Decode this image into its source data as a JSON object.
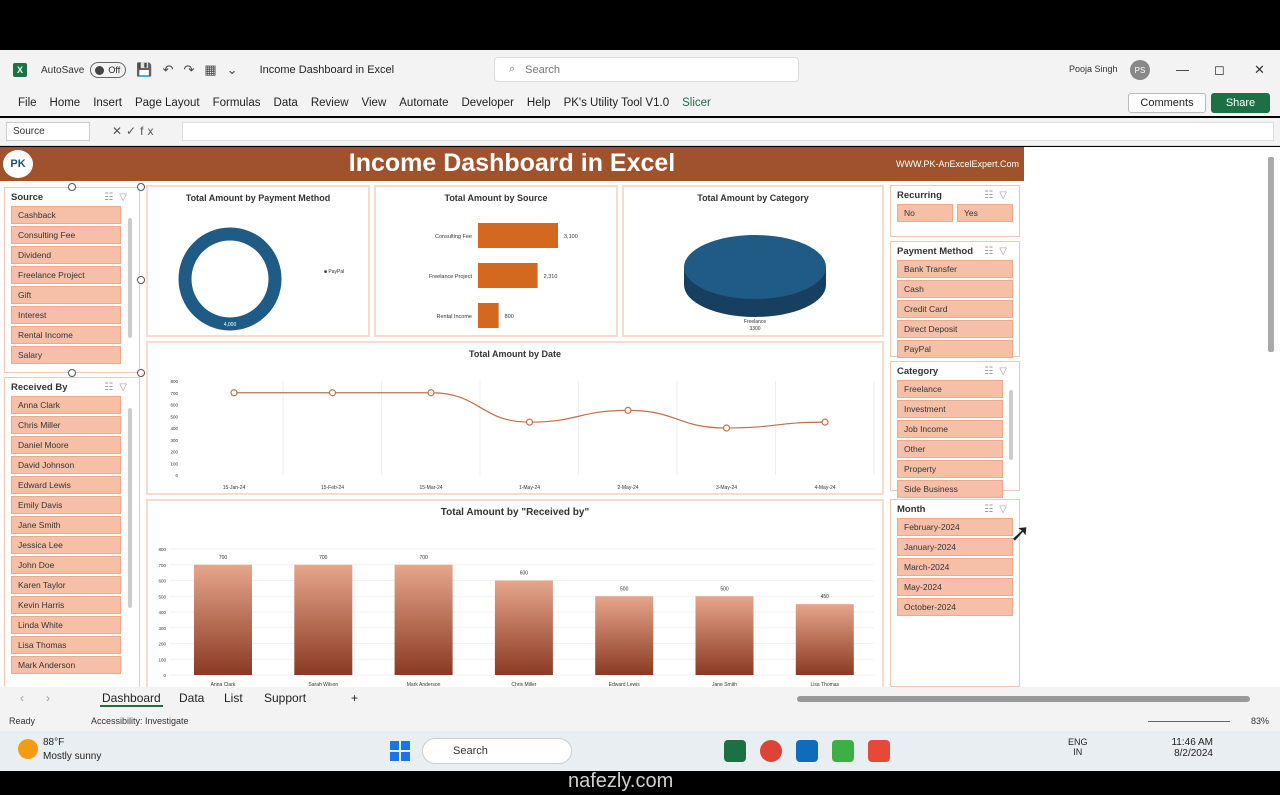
{
  "window": {
    "autosave_label": "AutoSave",
    "autosave_state": "Off",
    "doc_title": "Income Dashboard in Excel",
    "search_placeholder": "Search",
    "user_name": "Pooja Singh",
    "user_initials": "PS"
  },
  "ribbon": {
    "tabs": [
      "File",
      "Home",
      "Insert",
      "Page Layout",
      "Formulas",
      "Data",
      "Review",
      "View",
      "Automate",
      "Developer",
      "Help",
      "PK's Utility Tool V1.0",
      "Slicer"
    ],
    "comments_label": "Comments",
    "share_label": "Share"
  },
  "formula_bar": {
    "name_box": "Source",
    "fx": "fx"
  },
  "dashboard": {
    "title": "Income Dashboard in Excel",
    "url": "WWW.PK-AnExcelExpert.Com",
    "logo_text": "PK"
  },
  "slicers": {
    "source": {
      "title": "Source",
      "items": [
        "Cashback",
        "Consulting Fee",
        "Dividend",
        "Freelance Project",
        "Gift",
        "Interest",
        "Rental Income",
        "Salary"
      ]
    },
    "received_by": {
      "title": "Received By",
      "items": [
        "Anna Clark",
        "Chris Miller",
        "Daniel Moore",
        "David Johnson",
        "Edward Lewis",
        "Emily Davis",
        "Jane Smith",
        "Jessica Lee",
        "John Doe",
        "Karen Taylor",
        "Kevin Harris",
        "Linda White",
        "Lisa Thomas",
        "Mark Anderson"
      ]
    },
    "recurring": {
      "title": "Recurring",
      "items": [
        "No",
        "Yes"
      ]
    },
    "payment_method": {
      "title": "Payment Method",
      "items": [
        "Bank Transfer",
        "Cash",
        "Credit Card",
        "Direct Deposit",
        "PayPal"
      ]
    },
    "category": {
      "title": "Category",
      "items": [
        "Freelance",
        "Investment",
        "Job Income",
        "Other",
        "Property",
        "Side Business"
      ]
    },
    "month": {
      "title": "Month",
      "items": [
        "February-2024",
        "January-2024",
        "March-2024",
        "May-2024",
        "October-2024"
      ]
    }
  },
  "charts": {
    "payment": {
      "title": "Total Amount by Payment Method"
    },
    "source": {
      "title": "Total Amount by Source"
    },
    "category": {
      "title": "Total Amount by Category"
    },
    "date": {
      "title": "Total Amount by Date"
    },
    "received": {
      "title": "Total Amount by \"Received by\""
    }
  },
  "chart_data": [
    {
      "type": "pie",
      "title": "Total Amount by Payment Method",
      "categories": [
        "PayPal"
      ],
      "values": [
        4000
      ],
      "labels": [
        "PayPal",
        "4,000"
      ],
      "style": "doughnut"
    },
    {
      "type": "bar",
      "title": "Total Amount by Source",
      "orientation": "horizontal",
      "categories": [
        "Consulting Fee",
        "Freelance Project",
        "Rental Income"
      ],
      "values": [
        3100,
        2310,
        800
      ],
      "value_labels": [
        "3,100",
        "2,310",
        "800"
      ]
    },
    {
      "type": "pie",
      "title": "Total Amount by Category",
      "categories": [
        "Freelance"
      ],
      "values": [
        3300
      ],
      "labels": [
        "Freelance",
        "3300"
      ]
    },
    {
      "type": "line",
      "title": "Total Amount by Date",
      "x": [
        "15-Jan-24",
        "15-Feb-24",
        "15-Mar-24",
        "1-May-24",
        "2-May-24",
        "3-May-24",
        "4-May-24"
      ],
      "values": [
        700,
        700,
        700,
        450,
        550,
        400,
        450
      ],
      "yticks": [
        "800",
        "700",
        "600",
        "500",
        "400",
        "300",
        "200",
        "100",
        "0"
      ],
      "ylim": [
        0,
        800
      ]
    },
    {
      "type": "bar",
      "title": "Total Amount by \"Received by\"",
      "categories": [
        "Anna Clark",
        "Sarah Wilson",
        "Mark Anderson",
        "Chris Miller",
        "Edward Lewis",
        "Jane Smith",
        "Lisa Thomas"
      ],
      "values": [
        700,
        700,
        700,
        600,
        500,
        500,
        450
      ],
      "value_labels": [
        "700",
        "700",
        "700",
        "600",
        "500",
        "500",
        "450"
      ],
      "yticks": [
        "800",
        "700",
        "600",
        "500",
        "400",
        "300",
        "200",
        "100",
        "0"
      ],
      "ylim": [
        0,
        800
      ]
    }
  ],
  "sheet_tabs": [
    "Dashboard",
    "Data",
    "List",
    "Support"
  ],
  "status": {
    "ready": "Ready",
    "accessibility": "Accessibility: Investigate",
    "zoom": "83%"
  },
  "taskbar": {
    "temp": "88°F",
    "weather": "Mostly sunny",
    "search": "Search",
    "lang_1": "ENG",
    "lang_2": "IN",
    "time": "11:46 AM",
    "date": "8/2/2024"
  },
  "watermark": "nafezly.com"
}
